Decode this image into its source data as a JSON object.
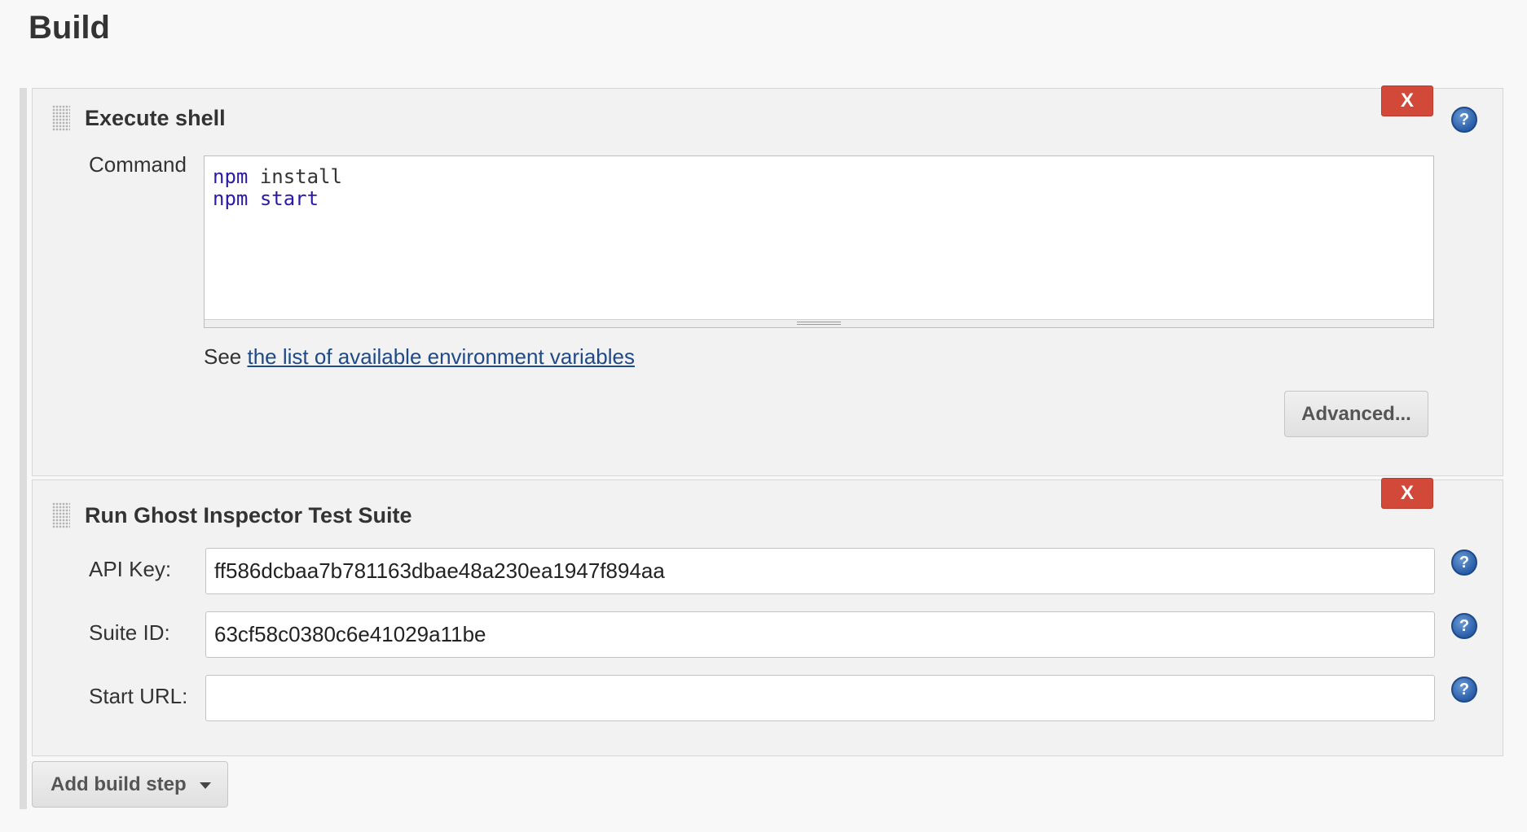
{
  "section": {
    "title": "Build"
  },
  "execute_shell": {
    "title": "Execute shell",
    "delete_label": "X",
    "help_icon": "question-mark-icon",
    "command_label": "Command",
    "command_lines": [
      {
        "cmd": "npm",
        "arg": "install"
      },
      {
        "cmd": "npm",
        "arg": "start"
      }
    ],
    "see_prefix": "See",
    "env_link_text": "the list of available environment variables",
    "advanced_label": "Advanced..."
  },
  "ghost_inspector": {
    "title": "Run Ghost Inspector Test Suite",
    "delete_label": "X",
    "help_icon": "question-mark-icon",
    "fields": {
      "api_key": {
        "label": "API Key:",
        "value": "ff586dcbaa7b781163dbae48a230ea1947f894aa"
      },
      "suite_id": {
        "label": "Suite ID:",
        "value": "63cf58c0380c6e41029a11be"
      },
      "start_url": {
        "label": "Start URL:",
        "value": ""
      }
    }
  },
  "footer": {
    "add_step_label": "Add build step"
  },
  "colors": {
    "delete_red": "#d24939",
    "link_blue": "#204a87",
    "shell_keyword": "#2a1aa6",
    "help_blue": "#2a5ea8"
  }
}
